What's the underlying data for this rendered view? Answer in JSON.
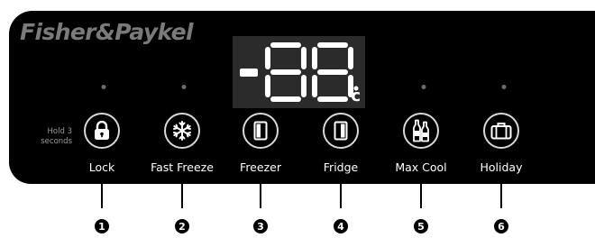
{
  "brand": "Fisher&Paykel",
  "display": {
    "reading": "-88",
    "unit": "c"
  },
  "hold_hint": "Hold 3 seconds",
  "buttons": [
    {
      "label": "Lock",
      "icon": "lock-icon",
      "number": "1"
    },
    {
      "label": "Fast Freeze",
      "icon": "snowflake-icon",
      "number": "2"
    },
    {
      "label": "Freezer",
      "icon": "freezer-icon",
      "number": "3"
    },
    {
      "label": "Fridge",
      "icon": "fridge-icon",
      "number": "4"
    },
    {
      "label": "Max Cool",
      "icon": "bottles-icon",
      "number": "5"
    },
    {
      "label": "Holiday",
      "icon": "suitcase-icon",
      "number": "6"
    }
  ],
  "colors": {
    "panel": "#000000",
    "brand": "#7a7a7a",
    "display_bg": "#2b2b2b",
    "button_ring": "#d8d8d8",
    "indicator": "#6b6b6b"
  }
}
